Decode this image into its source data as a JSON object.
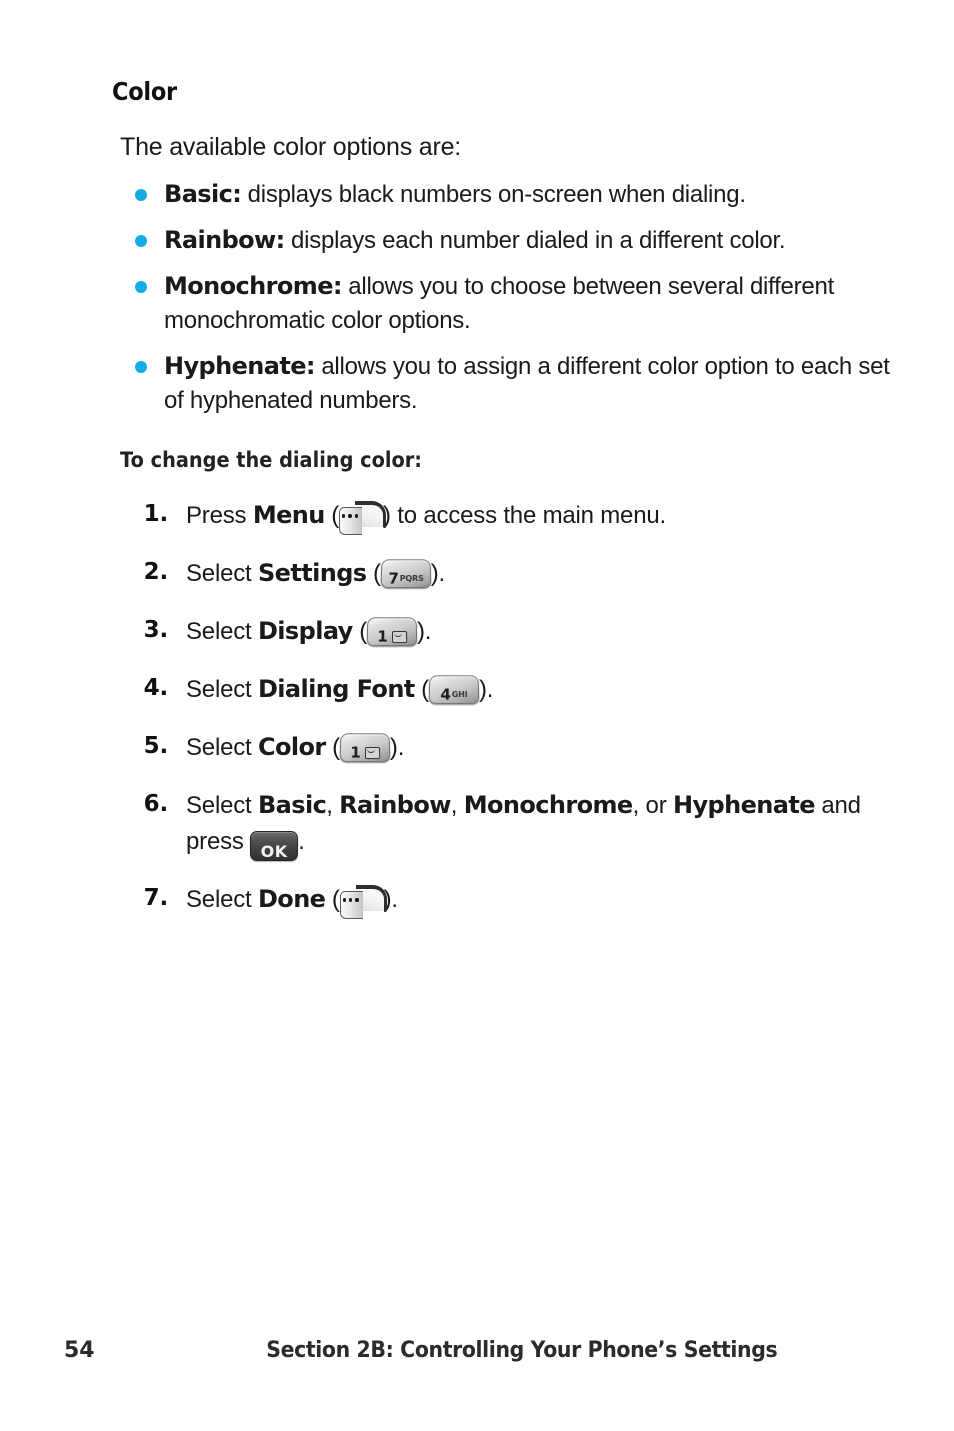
{
  "page": {
    "background_color": "#ffffff",
    "text_color": "#1a1a1a",
    "bullet_color": "#16aae6"
  },
  "section_heading": "Color",
  "intro": "The available color options are:",
  "bullets": [
    {
      "term": "Basic:",
      "description": " displays black numbers on-screen when dialing."
    },
    {
      "term": "Rainbow:",
      "description": " displays each number dialed in a different color."
    },
    {
      "term": "Monochrome:",
      "description": " allows you to choose between several different monochromatic color options."
    },
    {
      "term": "Hyphenate:",
      "description": " allows you to assign a different color option to each set of hyphenated numbers."
    }
  ],
  "sub_heading": "To change the dialing color:",
  "steps": [
    {
      "number": "1.",
      "lead": "Press ",
      "bold": "Menu",
      "paren_open": " (",
      "icon": "softkey-menu-icon",
      "paren_close": ") ",
      "tail": "to access the main menu."
    },
    {
      "number": "2.",
      "lead": "Select ",
      "bold": "Settings",
      "paren_open": " (",
      "icon": "key-7-pqrs-icon",
      "key_digit": "7",
      "key_letters": "PQRS",
      "paren_close": ").",
      "tail": ""
    },
    {
      "number": "3.",
      "lead": "Select ",
      "bold": "Display",
      "paren_open": " (",
      "icon": "key-1-voicemail-icon",
      "key_digit": "1",
      "key_letters": "",
      "paren_close": ").",
      "tail": ""
    },
    {
      "number": "4.",
      "lead": "Select ",
      "bold": "Dialing Font",
      "paren_open": " (",
      "icon": "key-4-ghi-icon",
      "key_digit": "4",
      "key_letters": "GHI",
      "paren_close": ").",
      "tail": ""
    },
    {
      "number": "5.",
      "lead": "Select ",
      "bold": "Color",
      "paren_open": " (",
      "icon": "key-1-voicemail-icon",
      "key_digit": "1",
      "key_letters": "",
      "paren_close": ").",
      "tail": ""
    },
    {
      "number": "6.",
      "lead": "Select ",
      "bold_1": "Basic",
      "sep_1": ", ",
      "bold_2": "Rainbow",
      "sep_2": ", ",
      "bold_3": "Monochrome",
      "sep_3": ", or ",
      "bold_4": "Hyphenate",
      "tail_1": " and press ",
      "icon": "key-ok-icon",
      "key_label": "OK",
      "tail_2": "."
    },
    {
      "number": "7.",
      "lead": "Select ",
      "bold": "Done",
      "paren_open": " (",
      "icon": "softkey-done-icon",
      "paren_close": ").",
      "tail": ""
    }
  ],
  "footer": {
    "page_number": "54",
    "section_title": "Section 2B: Controlling Your Phone’s Settings"
  }
}
